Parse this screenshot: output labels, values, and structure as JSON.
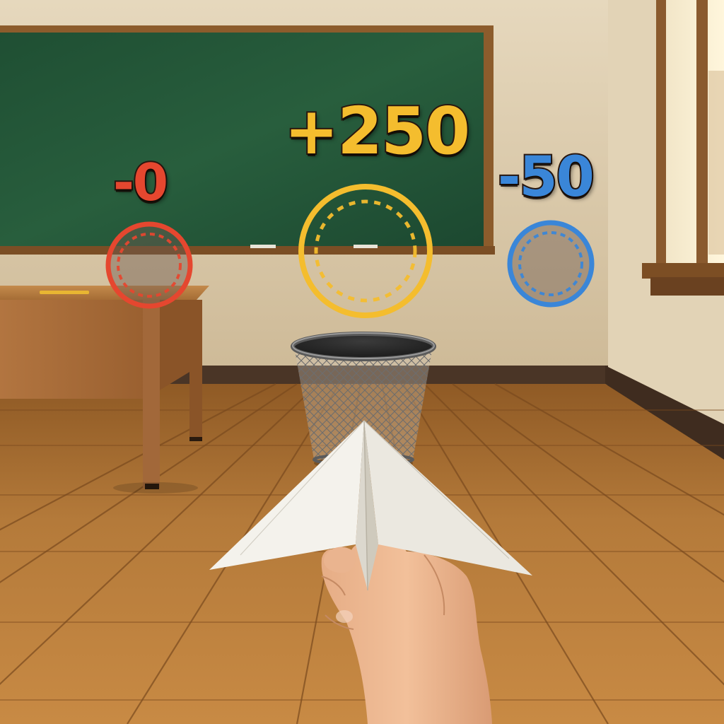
{
  "colors": {
    "penalty_small": "#e5472f",
    "bonus": "#f4bd2e",
    "penalty_large": "#3a86d8",
    "chalkboard": "#245a3a",
    "wall": "#dccdb3",
    "floor": "#b07a3c"
  },
  "targets": [
    {
      "id": "left",
      "label": "-0",
      "color": "#e5472f"
    },
    {
      "id": "center",
      "label": "+250",
      "color": "#f4bd2e"
    },
    {
      "id": "right",
      "label": "-50",
      "color": "#3a86d8"
    }
  ],
  "player": {
    "item": "paper-airplane"
  }
}
